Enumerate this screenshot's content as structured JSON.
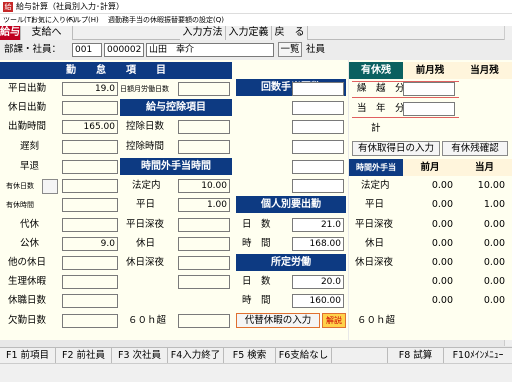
{
  "window": {
    "title": "給与計算（社員別入力･計算）"
  },
  "menu": [
    "ツール(T)",
    "お気に入り(F)",
    "ヘルプ(H)",
    "週勤務手当の休暇振替要額の設定(Q)"
  ],
  "toolbar": {
    "salary": "給与",
    "pay_target": "支給へ",
    "input_method": "入力方法",
    "input_def": "入力定義",
    "back": "戻　る"
  },
  "employee": {
    "label": "部課・社員：",
    "dept_code": "001",
    "emp_code": "000002",
    "name": "山田　幸介",
    "list_btn": "一覧",
    "type": "社員"
  },
  "kintai": {
    "header": "勤　　怠　　項　　目",
    "rows": [
      {
        "label": "平日出勤",
        "value": "19.0"
      },
      {
        "label": "休日出勤",
        "value": ""
      },
      {
        "label": "出勤時間",
        "value": "165.00"
      },
      {
        "label": "遅刻",
        "value": ""
      },
      {
        "label": "早退",
        "value": ""
      },
      {
        "label": "有休日数",
        "value": ""
      },
      {
        "label": "有休時間",
        "value": ""
      },
      {
        "label": "代休",
        "value": ""
      },
      {
        "label": "公休",
        "value": "9.0"
      },
      {
        "label": "他の休日",
        "value": ""
      },
      {
        "label": "生理休暇",
        "value": ""
      },
      {
        "label": "休職日数",
        "value": ""
      },
      {
        "label": "欠勤日数",
        "value": ""
      }
    ],
    "shotei_kinmu": "日額月労働日数"
  },
  "deduction": {
    "header": "給与控除項目",
    "rows": [
      {
        "label": "控除日数",
        "value": ""
      },
      {
        "label": "控除時間",
        "value": ""
      }
    ]
  },
  "overtime": {
    "header": "時間外手当時間",
    "rows": [
      {
        "label": "法定内",
        "value": "10.00"
      },
      {
        "label": "平日",
        "value": "1.00"
      },
      {
        "label": "平日深夜",
        "value": ""
      },
      {
        "label": "休日",
        "value": ""
      },
      {
        "label": "休日深夜",
        "value": ""
      },
      {
        "label": "",
        "value": ""
      },
      {
        "label": "６０ｈ超",
        "value": ""
      }
    ]
  },
  "count_pay": {
    "header": "回数手当回数"
  },
  "indiv": {
    "header": "個人別要出勤",
    "rows": [
      {
        "label": "日　数",
        "value": "21.0"
      },
      {
        "label": "時　間",
        "value": "168.00"
      }
    ]
  },
  "shotei": {
    "header": "所定労働",
    "rows": [
      {
        "label": "日　数",
        "value": "20.0"
      },
      {
        "label": "時　間",
        "value": "160.00"
      }
    ]
  },
  "substitute": {
    "label": "代替休暇の入力",
    "remove": "解説"
  },
  "paid_leave": {
    "header": "有休残",
    "prev": "前月残",
    "curr": "当月残",
    "carry": "繰　越　分",
    "current": "当　年　分",
    "total": "計",
    "input_btn": "有休取得日の入力",
    "confirm_btn": "有休残確認"
  },
  "ot_summary": {
    "header": "時間外手当",
    "prev": "前月",
    "curr": "当月",
    "rows": [
      {
        "label": "法定内",
        "prev": "0.00",
        "curr": "10.00"
      },
      {
        "label": "平日",
        "prev": "0.00",
        "curr": "1.00"
      },
      {
        "label": "平日深夜",
        "prev": "0.00",
        "curr": "0.00"
      },
      {
        "label": "休日",
        "prev": "0.00",
        "curr": "0.00"
      },
      {
        "label": "休日深夜",
        "prev": "0.00",
        "curr": "0.00"
      },
      {
        "label": "",
        "prev": "0.00",
        "curr": "0.00"
      },
      {
        "label": "６０ｈ超",
        "prev": "0.00",
        "curr": "0.00"
      }
    ]
  },
  "fkeys": [
    "F1 前項目",
    "F2 前社員",
    "F3 次社員",
    "F4入力終了",
    "F5 検索",
    "F6支給なし",
    "",
    "F8 試算",
    "F10ﾒｲﾝﾒﾆｭｰ"
  ],
  "colors": {
    "header_bg": "#0d3a82",
    "panel_bg": "#fffff0",
    "accent_red": "#c00020"
  }
}
